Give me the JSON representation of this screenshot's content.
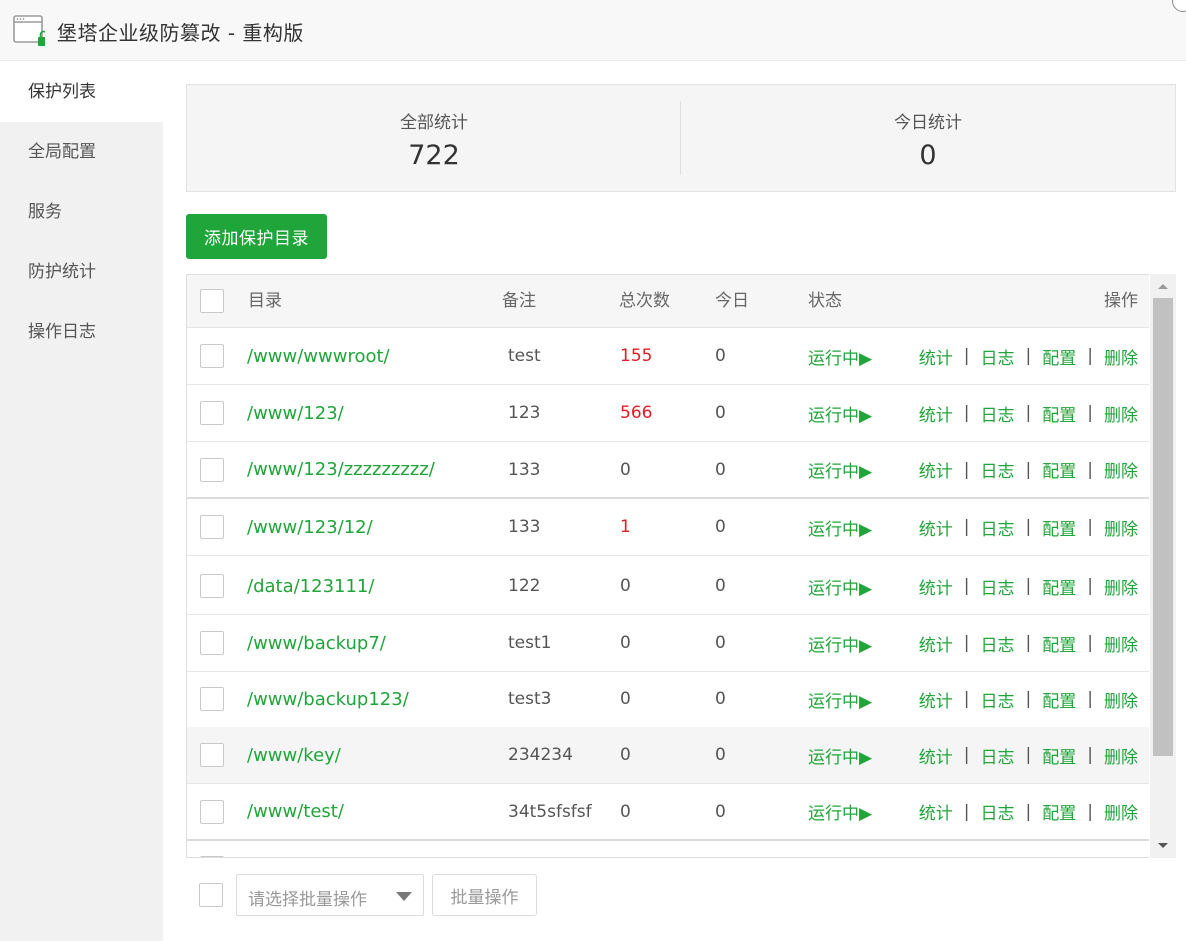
{
  "window": {
    "title": "堡塔企业级防篡改 - 重构版",
    "icon": "window-lock-icon"
  },
  "sidebar": {
    "items": [
      {
        "label": "保护列表",
        "active": true
      },
      {
        "label": "全局配置",
        "active": false
      },
      {
        "label": "服务",
        "active": false
      },
      {
        "label": "防护统计",
        "active": false
      },
      {
        "label": "操作日志",
        "active": false
      }
    ]
  },
  "summary": {
    "total": {
      "label": "全部统计",
      "value": "722"
    },
    "today": {
      "label": "今日统计",
      "value": "0"
    }
  },
  "toolbar": {
    "add_label": "添加保护目录"
  },
  "table": {
    "headers": {
      "dir": "目录",
      "remark": "备注",
      "total": "总次数",
      "today": "今日",
      "status": "状态",
      "ops": "操作"
    },
    "ops_labels": {
      "stats": "统计",
      "log": "日志",
      "config": "配置",
      "delete": "删除",
      "separator": "|"
    },
    "rows": [
      {
        "dir": "/www/wwwroot/",
        "remark": "test",
        "total": "155",
        "today": "0",
        "status": "运行中▶"
      },
      {
        "dir": "/www/123/",
        "remark": "123",
        "total": "566",
        "today": "0",
        "status": "运行中▶"
      },
      {
        "dir": "/www/123/zzzzzzzzz/",
        "remark": "133",
        "total": "0",
        "today": "0",
        "status": "运行中▶"
      },
      {
        "dir": "/www/123/12/",
        "remark": "133",
        "total": "1",
        "today": "0",
        "status": "运行中▶"
      },
      {
        "dir": "/data/123111/",
        "remark": "122",
        "total": "0",
        "today": "0",
        "status": "运行中▶"
      },
      {
        "dir": "/www/backup7/",
        "remark": "test1",
        "total": "0",
        "today": "0",
        "status": "运行中▶"
      },
      {
        "dir": "/www/backup123/",
        "remark": "test3",
        "total": "0",
        "today": "0",
        "status": "运行中▶"
      },
      {
        "dir": "/www/key/",
        "remark": "234234",
        "total": "0",
        "today": "0",
        "status": "运行中▶"
      },
      {
        "dir": "/www/test/",
        "remark": "34t5sfsfsf",
        "total": "0",
        "today": "0",
        "status": "运行中▶"
      }
    ]
  },
  "batch": {
    "select_placeholder": "请选择批量操作",
    "button_label": "批量操作"
  },
  "colors": {
    "accent": "#20a53a",
    "danger": "#e51c23"
  }
}
